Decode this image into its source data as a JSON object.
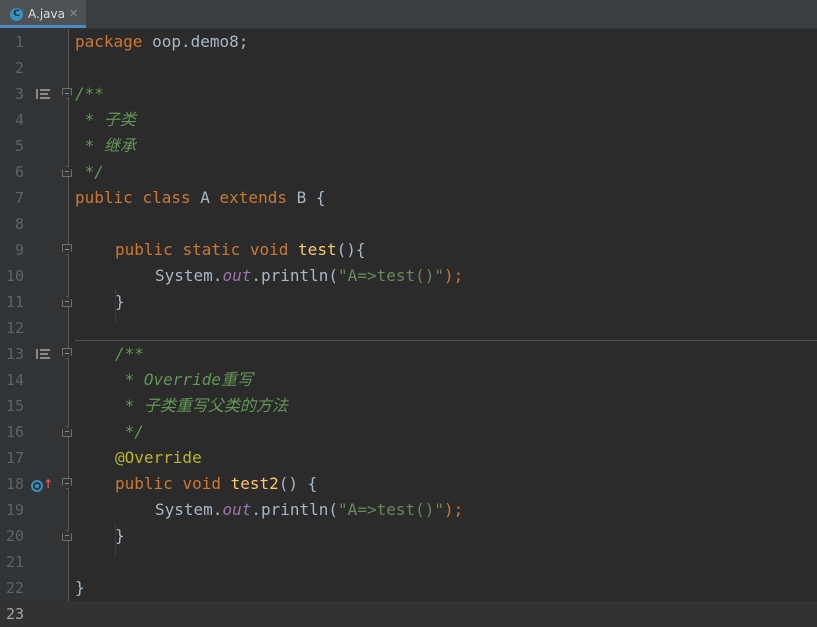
{
  "tab": {
    "icon": "C",
    "label": "A.java",
    "close": "✕"
  },
  "lines": [
    {
      "num": "1"
    },
    {
      "num": "2"
    },
    {
      "num": "3"
    },
    {
      "num": "4"
    },
    {
      "num": "5"
    },
    {
      "num": "6"
    },
    {
      "num": "7"
    },
    {
      "num": "8"
    },
    {
      "num": "9"
    },
    {
      "num": "10"
    },
    {
      "num": "11"
    },
    {
      "num": "12"
    },
    {
      "num": "13"
    },
    {
      "num": "14"
    },
    {
      "num": "15"
    },
    {
      "num": "16"
    },
    {
      "num": "17"
    },
    {
      "num": "18"
    },
    {
      "num": "19"
    },
    {
      "num": "20"
    },
    {
      "num": "21"
    },
    {
      "num": "22"
    },
    {
      "num": "23"
    }
  ],
  "code": {
    "l1": {
      "kw": "package",
      "rest": " oop.demo8;"
    },
    "l3": {
      "text": "/**"
    },
    "l4": {
      "text": " * 子类"
    },
    "l5": {
      "text": " * 继承"
    },
    "l6": {
      "text": " */"
    },
    "l7": {
      "kw1": "public",
      "kw2": "class",
      "name": "A",
      "kw3": "extends",
      "rest": " B {"
    },
    "l9": {
      "kw1": "public",
      "kw2": "static",
      "kw3": "void",
      "fn": "test",
      "rest": "(){"
    },
    "l10": {
      "cls": "System.",
      "field": "out",
      "call": ".println(",
      "str": "\"A=>test()\"",
      "end": ");"
    },
    "l11": {
      "text": "}"
    },
    "l13": {
      "text": "/**"
    },
    "l14": {
      "text": " * Override重写"
    },
    "l15": {
      "text": " * 子类重写父类的方法"
    },
    "l16": {
      "text": " */"
    },
    "l17": {
      "text": "@Override"
    },
    "l18": {
      "kw1": "public",
      "kw2": "void",
      "fn": "test2",
      "rest": "() {"
    },
    "l19": {
      "cls": "System.",
      "field": "out",
      "call": ".println(",
      "str": "\"A=>test()\"",
      "end": ");"
    },
    "l20": {
      "text": "}"
    },
    "l22": {
      "text": "}"
    }
  },
  "icons": {
    "doc_icon": "javadoc-render-icon",
    "override_icon": "overrides-method-icon",
    "fold_icon": "fold-marker-icon"
  },
  "colors": {
    "background": "#2b2b2b",
    "keyword": "#cc7832",
    "method": "#ffc66d",
    "string": "#6a8759",
    "doc": "#629755",
    "annotation": "#bbb529",
    "field": "#9876aa"
  }
}
